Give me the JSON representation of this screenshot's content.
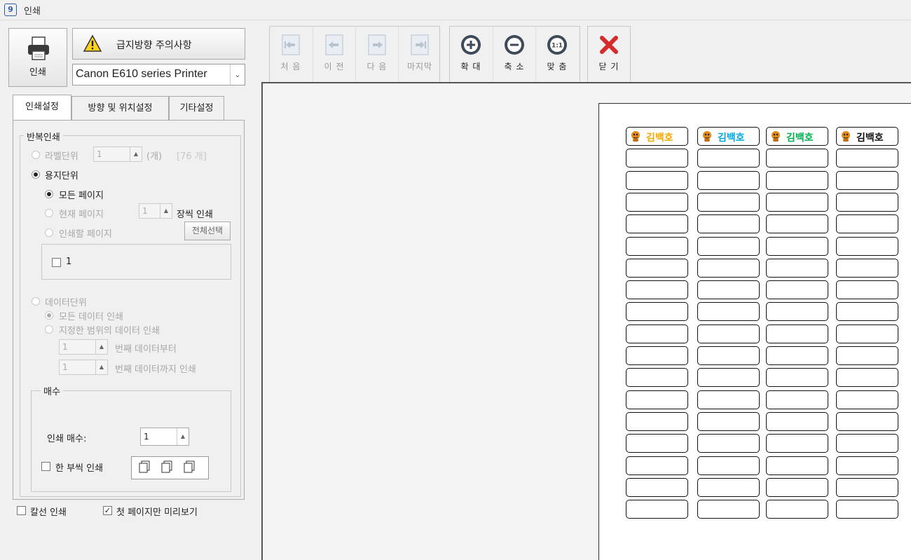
{
  "window": {
    "icon_text": "9",
    "title": "인쇄"
  },
  "print_button": {
    "label": "인쇄"
  },
  "warning_button": {
    "label": "급지방향 주의사항"
  },
  "printer": {
    "selected": "Canon E610 series Printer"
  },
  "tabs": [
    {
      "label": "인쇄설정",
      "active": true
    },
    {
      "label": "방향 및 위치설정",
      "active": false
    },
    {
      "label": "기타설정",
      "active": false
    }
  ],
  "repeat": {
    "legend": "반복인쇄",
    "label_unit": {
      "label": "라벨단위",
      "value": "1",
      "unit": "(개)",
      "count": "[76 개]"
    },
    "paper_unit": {
      "label": "용지단위"
    },
    "all_pages": {
      "label": "모든 페이지"
    },
    "current_page": {
      "label": "현재 페이지",
      "value": "1",
      "suffix": "장씩 인쇄"
    },
    "pages_to_print": {
      "label": "인쇄할 페이지",
      "select_all": "전체선택"
    },
    "page_list": [
      {
        "label": "1"
      }
    ],
    "data_unit": {
      "label": "데이터단위"
    },
    "all_data": {
      "label": "모든 데이터 인쇄"
    },
    "range_data": {
      "label": "지정한 범위의 데이터 인쇄"
    },
    "from": {
      "value": "1",
      "label": "번째 데이터부터"
    },
    "to": {
      "value": "1",
      "label": "번째 데이터까지 인쇄"
    }
  },
  "copies": {
    "legend": "매수",
    "count_label": "인쇄 매수:",
    "count_value": "1",
    "collate_label": "한 부씩 인쇄"
  },
  "bottom": {
    "cut_line": {
      "label": "칼선 인쇄",
      "checked": false
    },
    "first_page_only": {
      "label": "첫 페이지만 미리보기",
      "checked": true
    }
  },
  "toolbar": {
    "nav": [
      {
        "label": "처 음",
        "icon": "first-page-icon"
      },
      {
        "label": "이 전",
        "icon": "previous-page-icon"
      },
      {
        "label": "다 음",
        "icon": "next-page-icon"
      },
      {
        "label": "마지막",
        "icon": "last-page-icon"
      }
    ],
    "zoom": [
      {
        "label": "확 대",
        "icon": "zoom-in-icon",
        "glyph": "+"
      },
      {
        "label": "축 소",
        "icon": "zoom-out-icon",
        "glyph": "−"
      },
      {
        "label": "맞 춤",
        "icon": "fit-icon",
        "glyph": "1:1"
      }
    ],
    "close": {
      "label": "닫 기",
      "icon": "close-icon"
    }
  },
  "preview": {
    "label_name": "김백호",
    "header_colors": [
      "#f2a900",
      "#00a8e0",
      "#00b050",
      "#111111"
    ],
    "columns": 4,
    "rows": 18
  }
}
